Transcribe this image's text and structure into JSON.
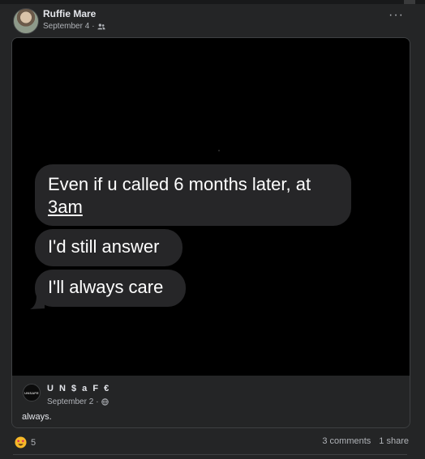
{
  "post": {
    "author": "Ruffie Mare",
    "date": "September 4",
    "separator": "·",
    "audience_icon": "friends-icon",
    "more_icon": "more-horizontal-icon",
    "more_label": "···"
  },
  "media": {
    "messages": [
      {
        "text_main": "Even if u called 6 months later, at",
        "text_underlined": "3am"
      },
      {
        "text": "I'd still answer"
      },
      {
        "text": "I'll always care"
      }
    ]
  },
  "shared": {
    "page_name": "U N $ a F €",
    "page_avatar_text": "UNSAFE",
    "date": "September 2",
    "separator": "·",
    "audience_icon": "globe-icon",
    "caption": "always."
  },
  "footer": {
    "reaction_icon": "star-struck-emoji-icon",
    "reaction_count": "5",
    "comments": "3 comments",
    "shares": "1 share"
  },
  "colors": {
    "background": "#242526",
    "text_primary": "#e4e6eb",
    "text_secondary": "#b0b3b8",
    "bubble": "#262628",
    "media_bg": "#000000"
  }
}
